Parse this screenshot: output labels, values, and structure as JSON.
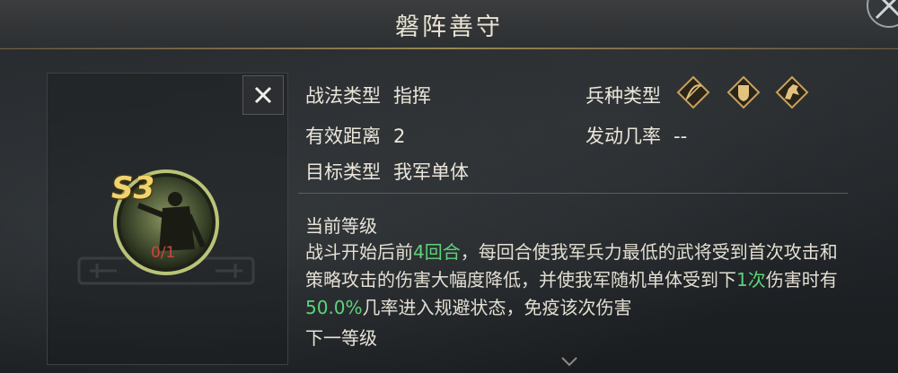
{
  "header": {
    "title": "磐阵善守"
  },
  "skill": {
    "grade": "S3",
    "count": "0/1",
    "type_label": "战法类型",
    "type_value": "指挥",
    "range_label": "有效距离",
    "range_value": "2",
    "target_label": "目标类型",
    "target_value": "我军单体",
    "troop_label": "兵种类型",
    "troop_icons": [
      "bow-cavalry-icon",
      "shield-infantry-icon",
      "horse-cavalry-icon"
    ],
    "rate_label": "发动几率",
    "rate_value": "--"
  },
  "description": {
    "current_title": "当前等级",
    "p1": "战斗开始后前",
    "h1": "4回合",
    "p2": "，每回合使我军兵力最低的武将受到首次攻击和策略攻击的伤害大幅度降低，并使我军随机单体受到下",
    "h2": "1次",
    "p3": "伤害时有",
    "h3": "50.0%",
    "p4": "几率进入规避状态，免疫该次伤害",
    "next_title": "下一等级"
  },
  "colors": {
    "highlight": "#5ed37a",
    "gold": "#f0d36c",
    "count": "#d0443a"
  }
}
